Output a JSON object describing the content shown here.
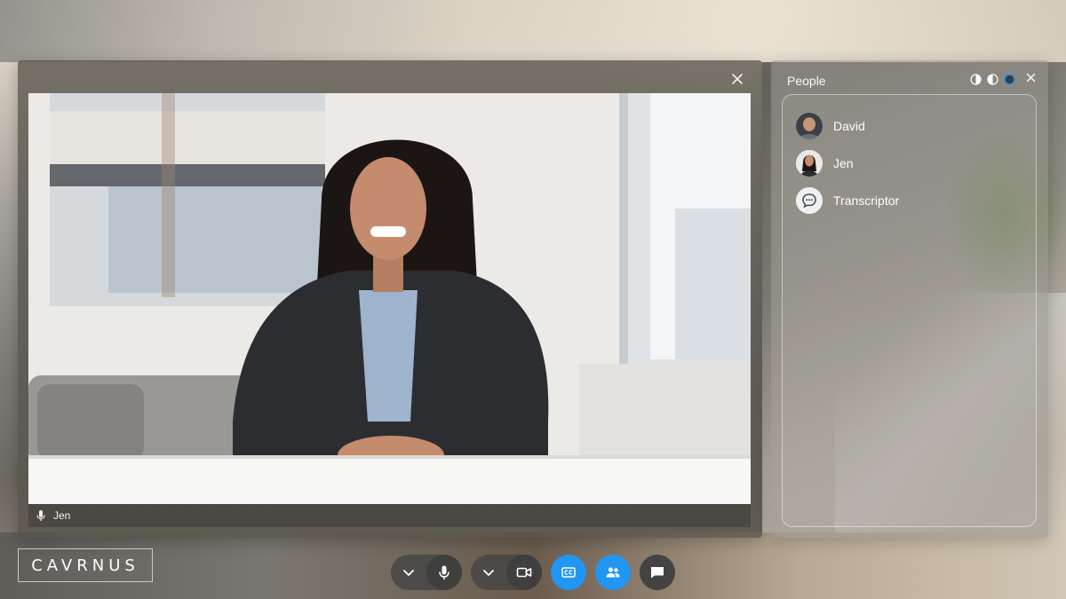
{
  "video": {
    "speaker_name": "Jen",
    "close_icon": "close-icon",
    "mic_icon": "microphone-icon"
  },
  "people_panel": {
    "title": "People",
    "tool_icons": [
      "contrast-light-icon",
      "contrast-mid-icon",
      "contrast-dark-icon"
    ],
    "close_icon": "close-icon",
    "participants": [
      {
        "name": "David",
        "avatar": "avatar-photo"
      },
      {
        "name": "Jen",
        "avatar": "avatar-photo"
      },
      {
        "name": "Transcriptor",
        "avatar": "chat-bubble-icon"
      }
    ]
  },
  "logo": {
    "text": "CAVRNUS"
  },
  "controls": {
    "buttons": [
      {
        "icon": "chevron-down-icon"
      },
      {
        "icon": "microphone-icon"
      },
      {
        "icon": "chevron-down-icon"
      },
      {
        "icon": "video-camera-icon"
      },
      {
        "icon": "closed-captions-icon"
      },
      {
        "icon": "people-icon"
      },
      {
        "icon": "chat-icon"
      }
    ],
    "accent_color": "#2196f3"
  }
}
